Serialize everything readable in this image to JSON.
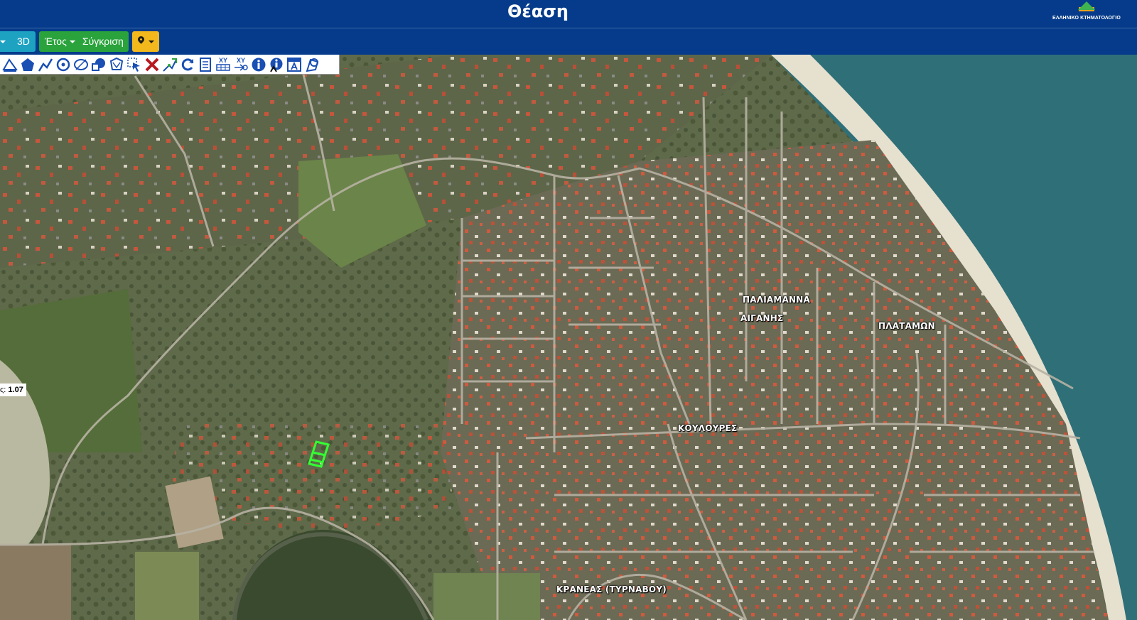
{
  "header": {
    "title": "Θέαση",
    "logo_text": "ΕΛΛΗΝΙΚΟ ΚΤΗΜΑΤΟΛΟΓΙΟ"
  },
  "toolbar": {
    "btn_3d": "3D",
    "btn_year": "Έτος",
    "btn_compare": "Σύγκριση"
  },
  "map_tools": [
    "measure-area-icon",
    "pentagon-icon",
    "polyline-icon",
    "circle-icon",
    "ellipse-icon",
    "lasso-icon",
    "polygon-select-icon",
    "select-arrow-icon",
    "delete-icon",
    "edit-vertex-icon",
    "refresh-icon",
    "report-icon",
    "xy-table-icon",
    "xy-goto-icon",
    "info-icon",
    "info-attribute-icon",
    "label-icon",
    "clear-selection-icon"
  ],
  "tool_labels": {
    "xy1": "XY",
    "xy2": "XY",
    "info": "i",
    "label": "A"
  },
  "scale": {
    "prefix": "ς:",
    "value": "1.07"
  },
  "places": [
    {
      "id": "paliamanna",
      "name": "ΠΑΛΙΑΜΑΝΝΑ"
    },
    {
      "id": "aiganis",
      "name": "ΑΙΓΑΝΗΣ"
    },
    {
      "id": "platamon",
      "name": "ΠΛΑΤΑΜΩΝ"
    },
    {
      "id": "kouloures",
      "name": "ΚΟΥΛΟΥΡΕΣ"
    },
    {
      "id": "kraneas",
      "name": "ΚΡΑΝΕΑΣ (ΤΥΡΝΑΒΟΥ)"
    }
  ],
  "colors": {
    "header": "#053b8a",
    "btn_3d": "#1ea2c2",
    "btn_green": "#2aa33c",
    "btn_marker": "#f2b81c",
    "parcel": "#33ff33",
    "sea": "#2f6f78",
    "beach": "#e6e0cf"
  }
}
